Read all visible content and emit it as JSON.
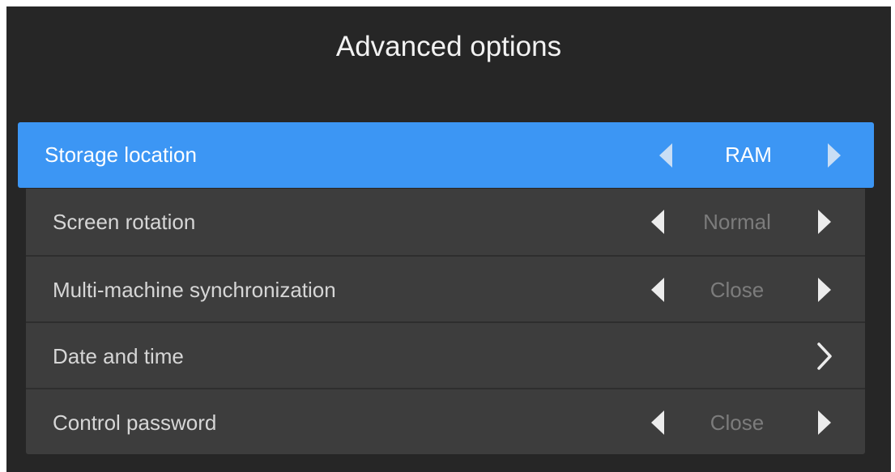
{
  "title": "Advanced options",
  "colors": {
    "background": "#262626",
    "panel": "#3d3d3d",
    "selected": "#3c96f4"
  },
  "rows": [
    {
      "label": "Storage location",
      "value": "RAM",
      "control": "selector",
      "selected": true
    },
    {
      "label": "Screen rotation",
      "value": "Normal",
      "control": "selector"
    },
    {
      "label": "Multi-machine synchronization",
      "value": "Close",
      "control": "selector"
    },
    {
      "label": "Date and time",
      "control": "submenu",
      "icon": "chevron-right-icon"
    },
    {
      "label": "Control password",
      "value": "Close",
      "control": "selector"
    }
  ]
}
